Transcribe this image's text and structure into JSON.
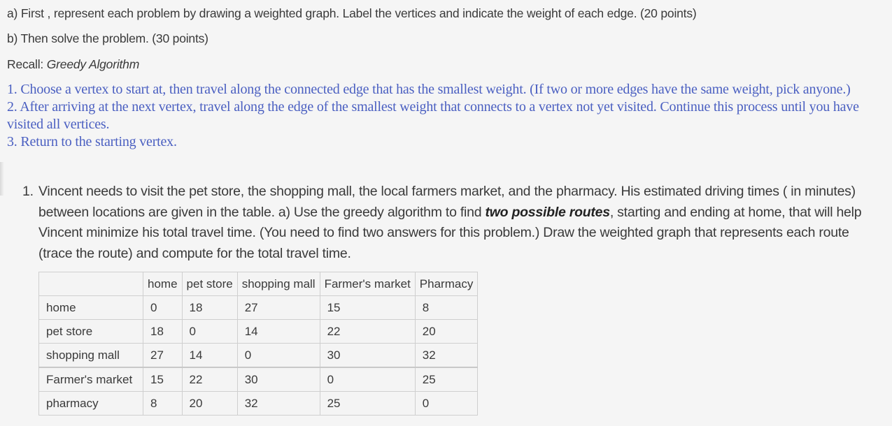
{
  "instructions": {
    "part_a": "a) First , represent each problem by drawing a weighted graph. Label the vertices and indicate the weight of each edge. (20 points)",
    "part_b": "b) Then solve the problem. (30 points)",
    "recall_label": "Recall: ",
    "recall_title": "Greedy Algorithm"
  },
  "greedy_steps": [
    "1. Choose a vertex to start at, then travel along the connected edge that has the smallest weight. (If two or more edges have the same weight, pick anyone.)",
    "2. After arriving at the next vertex, travel along the edge of the smallest weight that connects to a vertex not yet visited. Continue this process until you have visited all vertices.",
    "3. Return to the starting vertex."
  ],
  "problem": {
    "number": "1.",
    "text_before": "Vincent needs to visit the pet store, the shopping mall, the local farmers market, and the pharmacy. His estimated driving times ( in minutes) between locations are given in the table.   a)   Use the greedy algorithm to find ",
    "emphasis": "two possible routes",
    "text_after": ", starting and ending at home, that will help Vincent minimize his total travel time. (You need to find two answers for this problem.) Draw the weighted graph that represents each route (trace the route)  and compute for the total travel time."
  },
  "table": {
    "headers": [
      "",
      "home",
      "pet store",
      "shopping mall",
      "Farmer's market",
      "Pharmacy"
    ],
    "rows": [
      [
        "home",
        "0",
        "18",
        "27",
        "15",
        "8"
      ],
      [
        "pet store",
        "18",
        "0",
        "14",
        "22",
        "20"
      ],
      [
        "shopping mall",
        "27",
        "14",
        "0",
        "30",
        "32"
      ],
      [
        "Farmer's market",
        "15",
        "22",
        "30",
        "0",
        "25"
      ],
      [
        "pharmacy",
        "8",
        "20",
        "32",
        "25",
        "0"
      ]
    ]
  }
}
